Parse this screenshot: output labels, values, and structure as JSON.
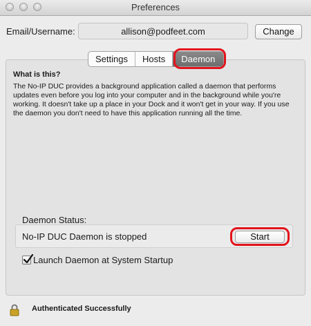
{
  "window": {
    "title": "Preferences"
  },
  "account": {
    "email_label": "Email/Username:",
    "email_value": "allison@podfeet.com",
    "change_label": "Change"
  },
  "tabs": [
    {
      "label": "Settings",
      "selected": false
    },
    {
      "label": "Hosts",
      "selected": false
    },
    {
      "label": "Daemon",
      "selected": true
    }
  ],
  "daemon": {
    "heading": "What is this?",
    "description": "The No-IP DUC provides a background application called a daemon that performs updates even before you log into your computer and in the background while you're working. It doesn't take up a place in your Dock and it won't get in your way. If you use the daemon you don't need to have this application running all the time.",
    "status_label": "Daemon Status:",
    "status_text": "No-IP DUC Daemon is stopped",
    "start_label": "Start",
    "launch_checkbox_label": "Launch Daemon at System Startup",
    "launch_checked": true
  },
  "footer": {
    "auth_status": "Authenticated Successfully"
  },
  "colors": {
    "highlight": "#e3131b",
    "selected_tab": "#7a7a7a"
  },
  "icons": [
    "lock-icon",
    "checkmark-icon"
  ]
}
